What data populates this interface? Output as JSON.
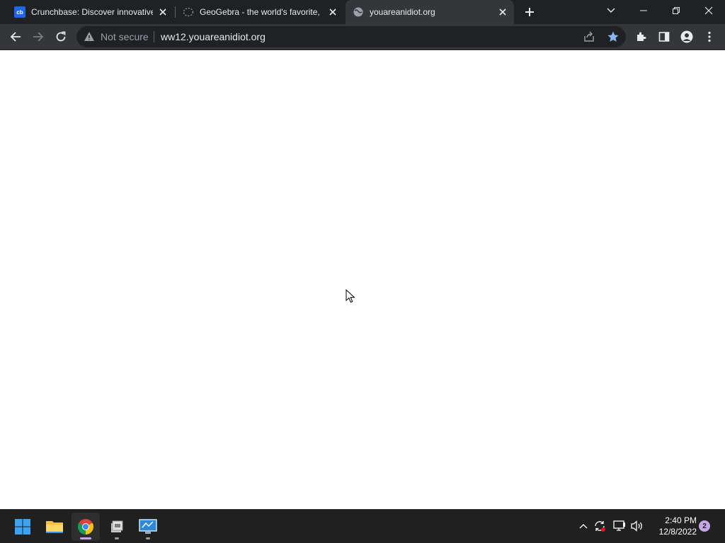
{
  "browser": {
    "tabs": [
      {
        "title": "Crunchbase: Discover innovative",
        "favicon": "cb",
        "active": false
      },
      {
        "title": "GeoGebra - the world's favorite,",
        "favicon": "geogebra-icon",
        "active": false
      },
      {
        "title": "youareanidiot.org",
        "favicon": "globe-icon",
        "active": true
      }
    ],
    "toolbar": {
      "security_label": "Not secure",
      "url": "ww12.youareanidiot.org",
      "bookmarked": true
    }
  },
  "taskbar": {
    "apps": [
      {
        "name": "start",
        "icon": "windows-logo-icon"
      },
      {
        "name": "file-explorer",
        "icon": "folder-icon"
      },
      {
        "name": "chrome",
        "icon": "chrome-icon",
        "active": true
      },
      {
        "name": "app-3",
        "icon": "app-icon"
      },
      {
        "name": "app-4",
        "icon": "remote-desktop-icon"
      }
    ],
    "clock": {
      "time": "2:40 PM",
      "date": "12/8/2022"
    },
    "notification_count": "2"
  },
  "colors": {
    "tab_bar": "#202124",
    "toolbar": "#35363a",
    "omnibox": "#202124",
    "accent_star": "#8ab4f8",
    "taskbar": "#202020"
  }
}
